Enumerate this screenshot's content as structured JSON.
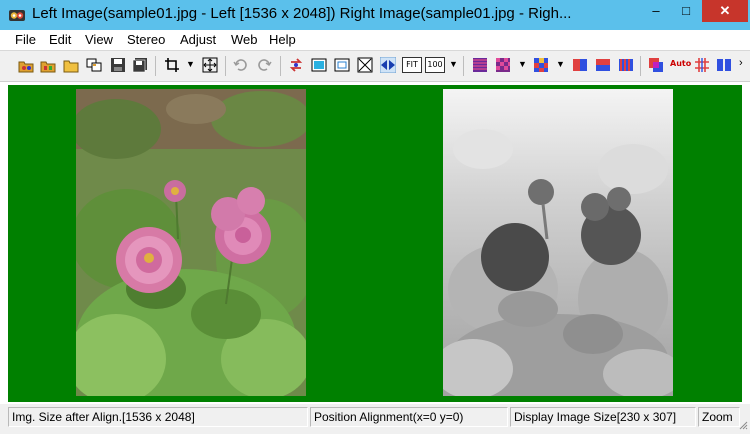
{
  "window": {
    "title": "Left Image(sample01.jpg - Left [1536 x 2048]) Right Image(sample01.jpg - Righ...",
    "minimize": "–",
    "maximize": "□",
    "close": "✕"
  },
  "menu": {
    "items": [
      "File",
      "Edit",
      "View",
      "Stereo",
      "Adjust",
      "Web",
      "Help"
    ]
  },
  "toolbar": {
    "fit_label": "FIT",
    "zoom100_label": "100",
    "auto_label": "Auto"
  },
  "viewport": {
    "background": "#008000",
    "left_image": "color photo of pink dahlias",
    "right_image": "grayscale depth map"
  },
  "statusbar": {
    "align_size": "Img. Size after Align.[1536 x 2048]",
    "position": "Position Alignment(x=0 y=0)",
    "display_size": "Display Image Size[230 x 307]",
    "zoom": "Zoom"
  }
}
